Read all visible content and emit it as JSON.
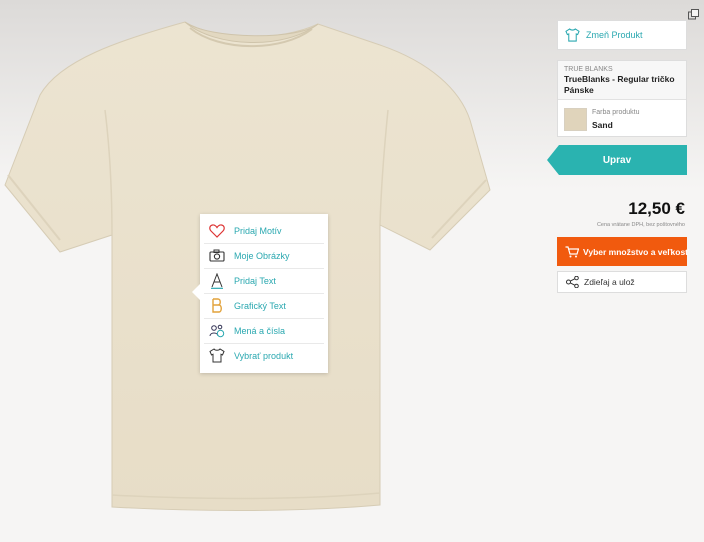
{
  "product_panel": {
    "change_product_label": "Zmeň Produkt",
    "brand": "TRUE BLANKS",
    "product_name": "TrueBlanks - Regular tričko Pánske",
    "color_label": "Farba produktu",
    "color_value": "Sand",
    "swatch_color": "#e0d4bb",
    "edit_label": "Uprav",
    "price": "12,50 €",
    "price_note": "Cena vrátane DPH, bez poštovného",
    "buy_label": "Vyber množstvo a veľkosť",
    "share_label": "Zdieľaj a ulož"
  },
  "design_menu": {
    "items": [
      {
        "label": "Pridaj Motív",
        "icon": "heart-icon"
      },
      {
        "label": "Moje Obrázky",
        "icon": "camera-icon"
      },
      {
        "label": "Pridaj Text",
        "icon": "letter-a-icon"
      },
      {
        "label": "Grafický Text",
        "icon": "letter-b-icon"
      },
      {
        "label": "Mená a čísla",
        "icon": "names-numbers-icon"
      },
      {
        "label": "Vybrať produkt",
        "icon": "tshirt-icon"
      }
    ]
  },
  "colors": {
    "accent_teal": "#2aa8b0",
    "buy_orange": "#f15a0e",
    "shirt_sand": "#e9e0cb"
  }
}
